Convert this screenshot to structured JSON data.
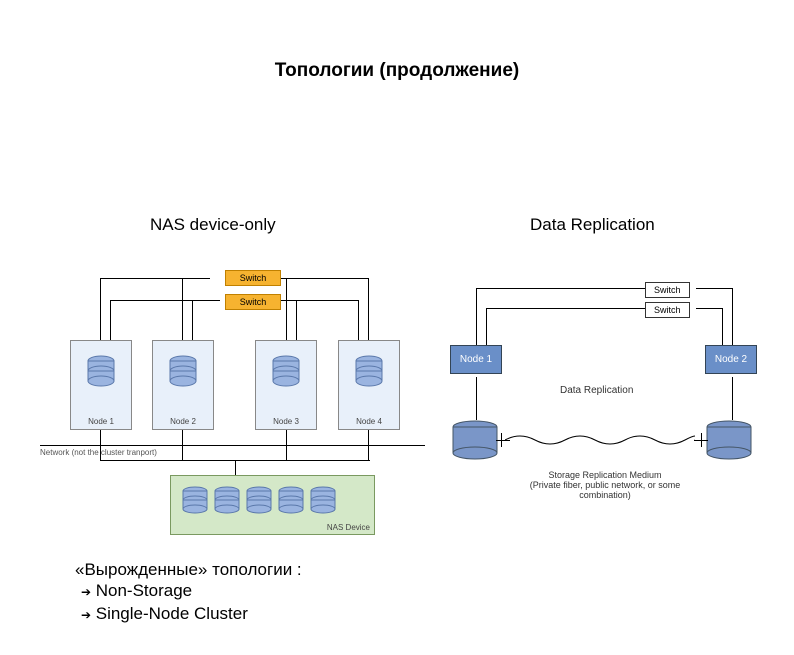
{
  "title": "Топологии (продолжение)",
  "subtitles": {
    "left": "NAS device-only",
    "right": "Data Replication"
  },
  "left": {
    "switch": "Switch",
    "nodes": [
      "Node 1",
      "Node 2",
      "Node 3",
      "Node 4"
    ],
    "nas": "NAS Device",
    "net": "Network (not the cluster tranport)"
  },
  "right": {
    "switch": "Switch",
    "nodes": [
      "Node 1",
      "Node 2"
    ],
    "dr": "Data Replication",
    "medium1": "Storage Replication Medium",
    "medium2": "(Private fiber, public network, or some combination)"
  },
  "bottom": {
    "heading": "«Вырожденные» топологии :",
    "items": [
      "Non-Storage",
      "Single-Node Cluster"
    ]
  }
}
